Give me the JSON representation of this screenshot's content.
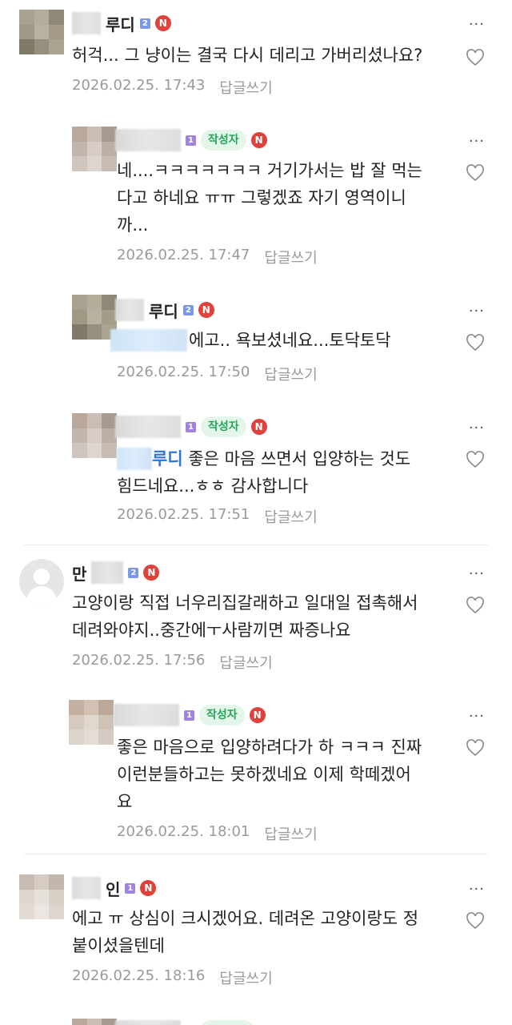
{
  "comments": [
    {
      "nick": "루디",
      "level": "2",
      "text": "허걱... 그 냥이는 결국 다시 데리고 가버리셨나요?",
      "time": "2026.02.25. 17:43",
      "reply": "답글쓰기"
    },
    {
      "writer": "작성자",
      "level": "1",
      "text1": "네....ㅋㅋㅋㅋㅋㅋㅋ 거기가서는 밥 잘 먹는",
      "text2": "다고 하네요 ㅠㅠ 그렇겠죠 자기 영역이니",
      "text3": "까...",
      "time": "2026.02.25. 17:47",
      "reply": "답글쓰기"
    },
    {
      "nick": "루디",
      "level": "2",
      "text": "에고.. 욕보셨네요...토닥토닥",
      "time": "2026.02.25. 17:50",
      "reply": "답글쓰기"
    },
    {
      "writer": "작성자",
      "level": "1",
      "mention": "루디",
      "text1": " 좋은 마음 쓰면서 입양하는 것도",
      "text2": "힘드네요...ㅎㅎ 감사합니다",
      "time": "2026.02.25. 17:51",
      "reply": "답글쓰기"
    },
    {
      "nick": "만",
      "level": "2",
      "text1": "고양이랑 직접 너우리집갈래하고 일대일 접촉해서",
      "text2": "데려와야지..중간에ㅜ사람끼면 짜증나요",
      "time": "2026.02.25. 17:56",
      "reply": "답글쓰기"
    },
    {
      "writer": "작성자",
      "level": "1",
      "text1": "좋은 마음으로 입양하려다가 하 ㅋㅋㅋ 진짜",
      "text2": "이런분들하고는 못하겠네요 이제 학떼겠어",
      "text3": "요",
      "time": "2026.02.25. 18:01",
      "reply": "답글쓰기"
    },
    {
      "nick": "인",
      "level": "1",
      "text1": "에고 ㅠ 상심이 크시겠어요. 데려온 고양이랑도 정",
      "text2": "붙이셨을텐데",
      "time": "2026.02.25. 18:16",
      "reply": "답글쓰기"
    }
  ],
  "badge_new": "N",
  "more_label": "···",
  "colors": {
    "mention": "#2f75d6",
    "writer_bg": "#e4f6ea",
    "writer_fg": "#23a55a",
    "new": "#e0413a"
  }
}
